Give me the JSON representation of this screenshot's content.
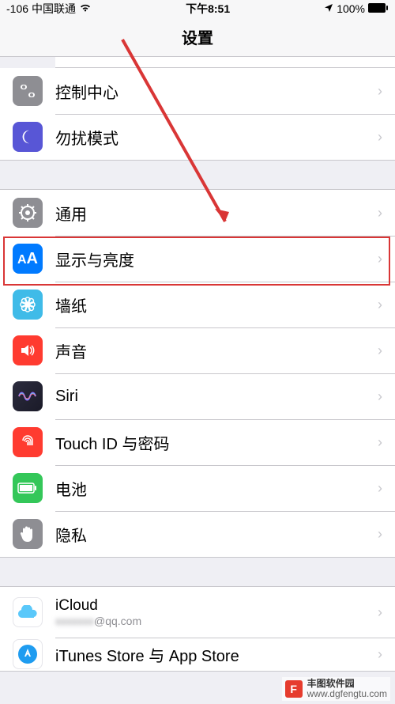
{
  "status": {
    "signal": "-106",
    "carrier": "中国联通",
    "time": "下午8:51",
    "battery": "100%"
  },
  "nav": {
    "title": "设置"
  },
  "group1": {
    "items": [
      {
        "label": "控制中心",
        "iconColor": "#8e8e93"
      },
      {
        "label": "勿扰模式",
        "iconColor": "#5856d6"
      }
    ]
  },
  "group2": {
    "items": [
      {
        "label": "通用",
        "iconColor": "#8e8e93"
      },
      {
        "label": "显示与亮度",
        "iconColor": "#007aff"
      },
      {
        "label": "墙纸",
        "iconColor": "#55c3e8"
      },
      {
        "label": "声音",
        "iconColor": "#ff3b30"
      },
      {
        "label": "Siri",
        "iconColor": "#1c1c1e"
      },
      {
        "label": "Touch ID 与密码",
        "iconColor": "#ff3b30"
      },
      {
        "label": "电池",
        "iconColor": "#34c759"
      },
      {
        "label": "隐私",
        "iconColor": "#8e8e93"
      }
    ]
  },
  "group3": {
    "icloud": {
      "label": "iCloud",
      "sub": "@qq.com"
    },
    "appstore": {
      "label": "iTunes Store 与 App Store"
    }
  },
  "watermark": {
    "logo": "F",
    "title": "丰图软件园",
    "url": "www.dgfengtu.com"
  }
}
